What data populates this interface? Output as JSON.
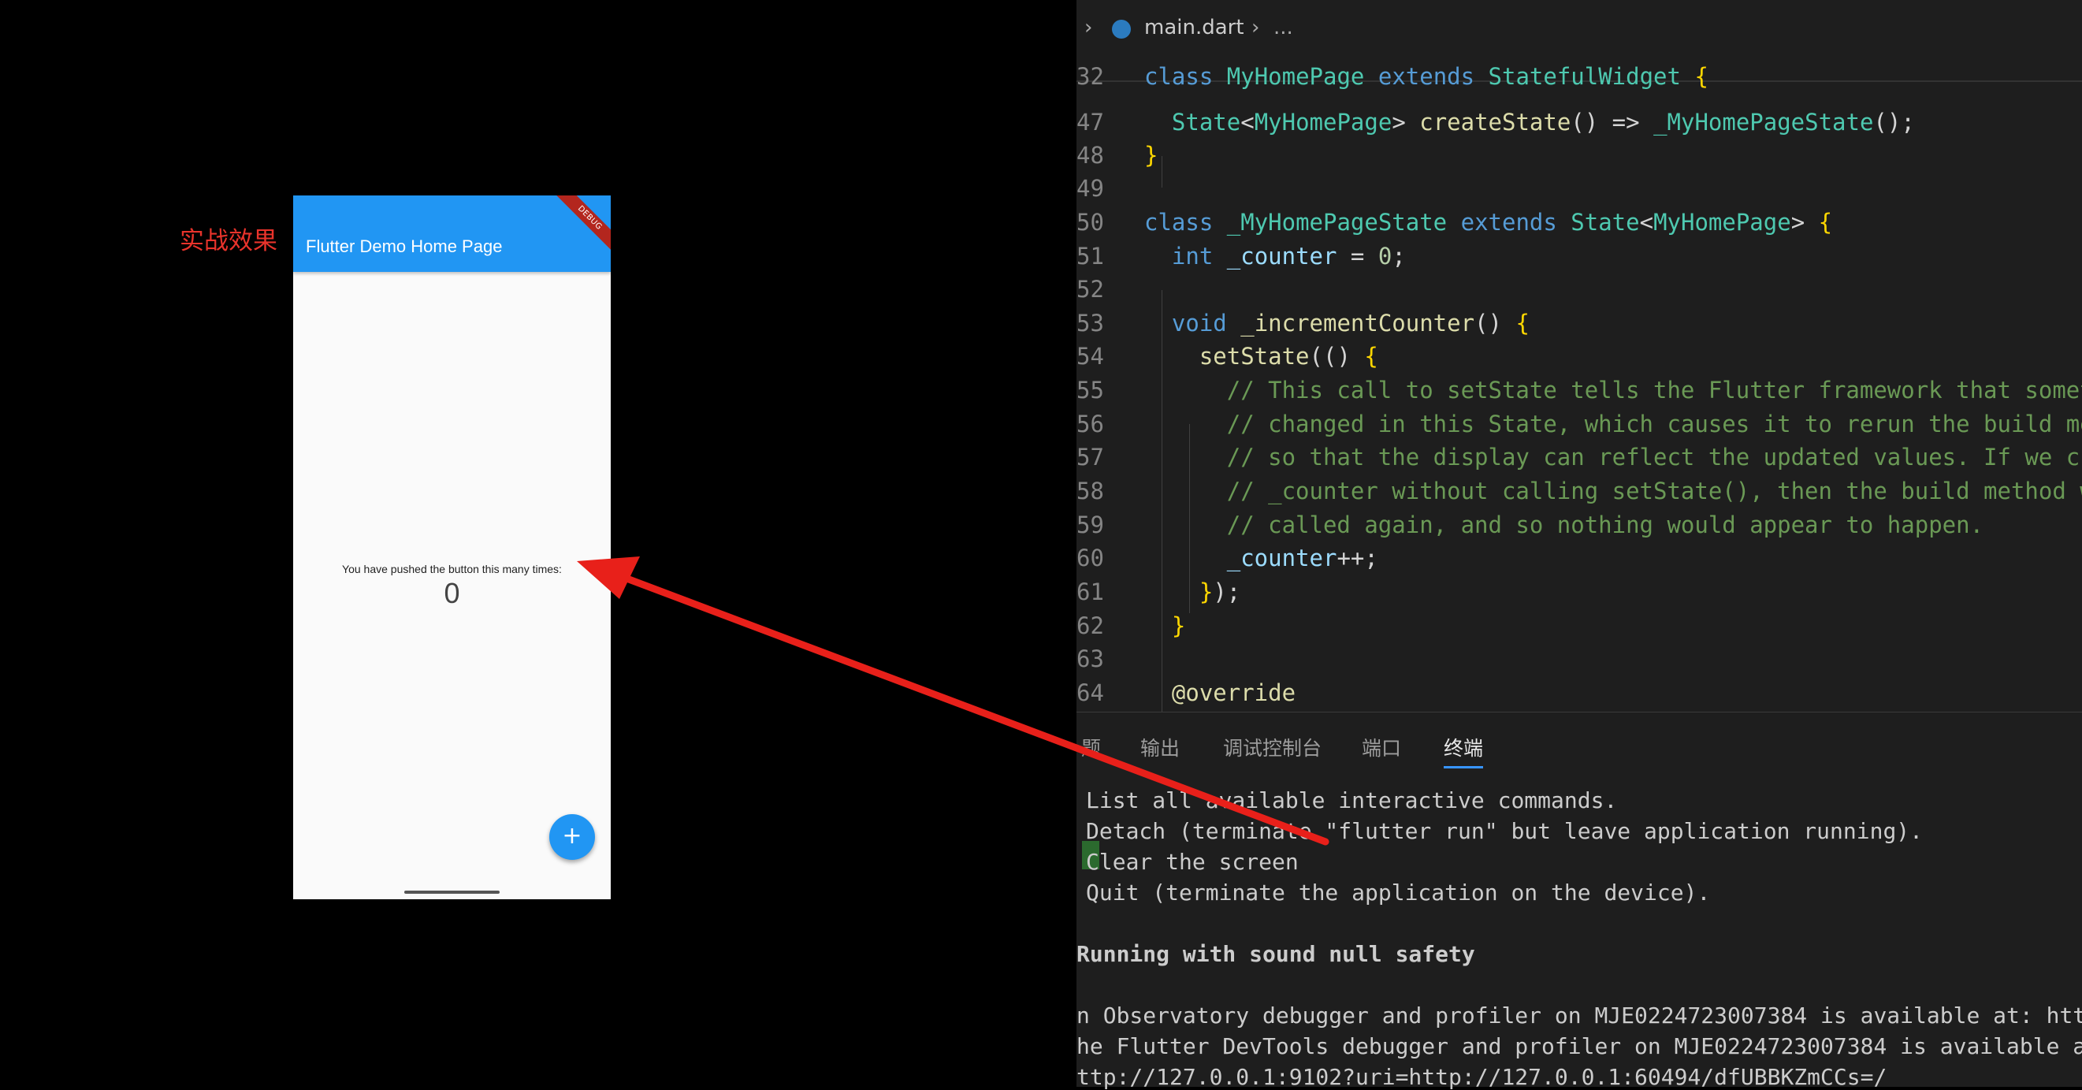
{
  "annotation": {
    "label": "实战效果"
  },
  "phone": {
    "appbar_title": "Flutter Demo Home Page",
    "debug_banner": "DEBUG",
    "counter_label": "You have pushed the button this many times:",
    "counter_value": "0",
    "fab_label": "+",
    "colors": {
      "primary": "#2196f3",
      "background": "#fafafa"
    }
  },
  "editor": {
    "breadcrumb": {
      "file": "main.dart",
      "more": "..."
    },
    "lines": [
      {
        "ln": "32",
        "text": "class MyHomePage extends StatefulWidget {"
      },
      {
        "ln": "47",
        "text": "  State<MyHomePage> createState() => _MyHomePageState();"
      },
      {
        "ln": "48",
        "text": "}"
      },
      {
        "ln": "49",
        "text": ""
      },
      {
        "ln": "50",
        "text": "class _MyHomePageState extends State<MyHomePage> {"
      },
      {
        "ln": "51",
        "text": "  int _counter = 0;"
      },
      {
        "ln": "52",
        "text": ""
      },
      {
        "ln": "53",
        "text": "  void _incrementCounter() {"
      },
      {
        "ln": "54",
        "text": "    setState(() {"
      },
      {
        "ln": "55",
        "text": "      // This call to setState tells the Flutter framework that somet"
      },
      {
        "ln": "56",
        "text": "      // changed in this State, which causes it to rerun the build me"
      },
      {
        "ln": "57",
        "text": "      // so that the display can reflect the updated values. If we ch"
      },
      {
        "ln": "58",
        "text": "      // _counter without calling setState(), then the build method w"
      },
      {
        "ln": "59",
        "text": "      // called again, and so nothing would appear to happen."
      },
      {
        "ln": "60",
        "text": "      _counter++;"
      },
      {
        "ln": "61",
        "text": "    });"
      },
      {
        "ln": "62",
        "text": "  }"
      },
      {
        "ln": "63",
        "text": ""
      },
      {
        "ln": "64",
        "text": "  @override"
      }
    ]
  },
  "panel": {
    "tabs": [
      "题",
      "输出",
      "调试控制台",
      "端口",
      "终端"
    ],
    "active_tab": "终端",
    "terminal": [
      "List all available interactive commands.",
      "Detach (terminate \"flutter run\" but leave application running).",
      "Clear the screen",
      "Quit (terminate the application on the device).",
      "",
      "Running with sound null safety",
      "",
      "n Observatory debugger and profiler on MJE0224723007384 is available at: http:",
      "he Flutter DevTools debugger and profiler on MJE0224723007384 is available at:",
      "ttp://127.0.0.1:9102?uri=http://127.0.0.1:60494/dfUBBKZmCCs=/"
    ]
  }
}
